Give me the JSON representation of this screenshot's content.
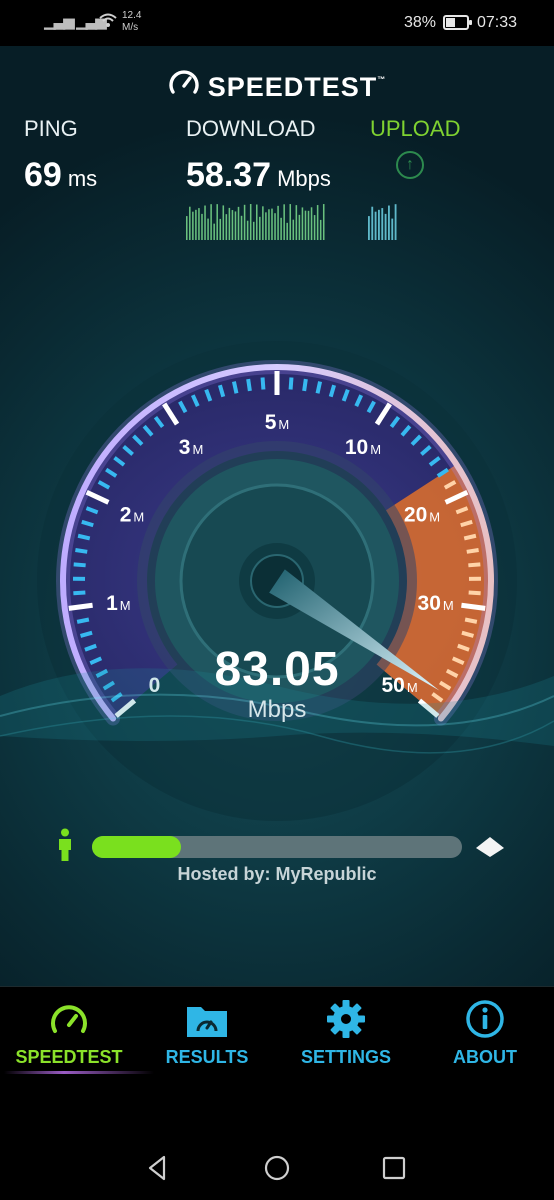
{
  "status_bar": {
    "network_speed_value": "12.4",
    "network_speed_unit": "M/s",
    "battery_percent": "38%",
    "time": "07:33"
  },
  "app": {
    "brand": "SPEEDTEST",
    "trademark": "™"
  },
  "stats": {
    "ping": {
      "label": "PING",
      "value": "69",
      "unit": "ms"
    },
    "download": {
      "label": "DOWNLOAD",
      "value": "58.37",
      "unit": "Mbps"
    },
    "upload": {
      "label": "UPLOAD"
    }
  },
  "gauge": {
    "current_value": "83.05",
    "current_unit": "Mbps",
    "ticks": [
      {
        "num": "0",
        "unit": ""
      },
      {
        "num": "1",
        "unit": "M"
      },
      {
        "num": "2",
        "unit": "M"
      },
      {
        "num": "3",
        "unit": "M"
      },
      {
        "num": "5",
        "unit": "M"
      },
      {
        "num": "10",
        "unit": "M"
      },
      {
        "num": "20",
        "unit": "M"
      },
      {
        "num": "30",
        "unit": "M"
      },
      {
        "num": "50",
        "unit": "M"
      }
    ]
  },
  "progress": {
    "fraction": 0.24,
    "hosted_by": "Hosted by: MyRepublic"
  },
  "bottom_nav": [
    {
      "label": "SPEEDTEST",
      "icon": "speedometer-icon",
      "active": true
    },
    {
      "label": "RESULTS",
      "icon": "folder-icon",
      "active": false
    },
    {
      "label": "SETTINGS",
      "icon": "gear-icon",
      "active": false
    },
    {
      "label": "ABOUT",
      "icon": "info-icon",
      "active": false
    }
  ],
  "colors": {
    "accent_green": "#8be22a",
    "accent_blue": "#2fb6e6",
    "gauge_orange": "#e57a2f",
    "gauge_purple": "#5b4fa8"
  }
}
